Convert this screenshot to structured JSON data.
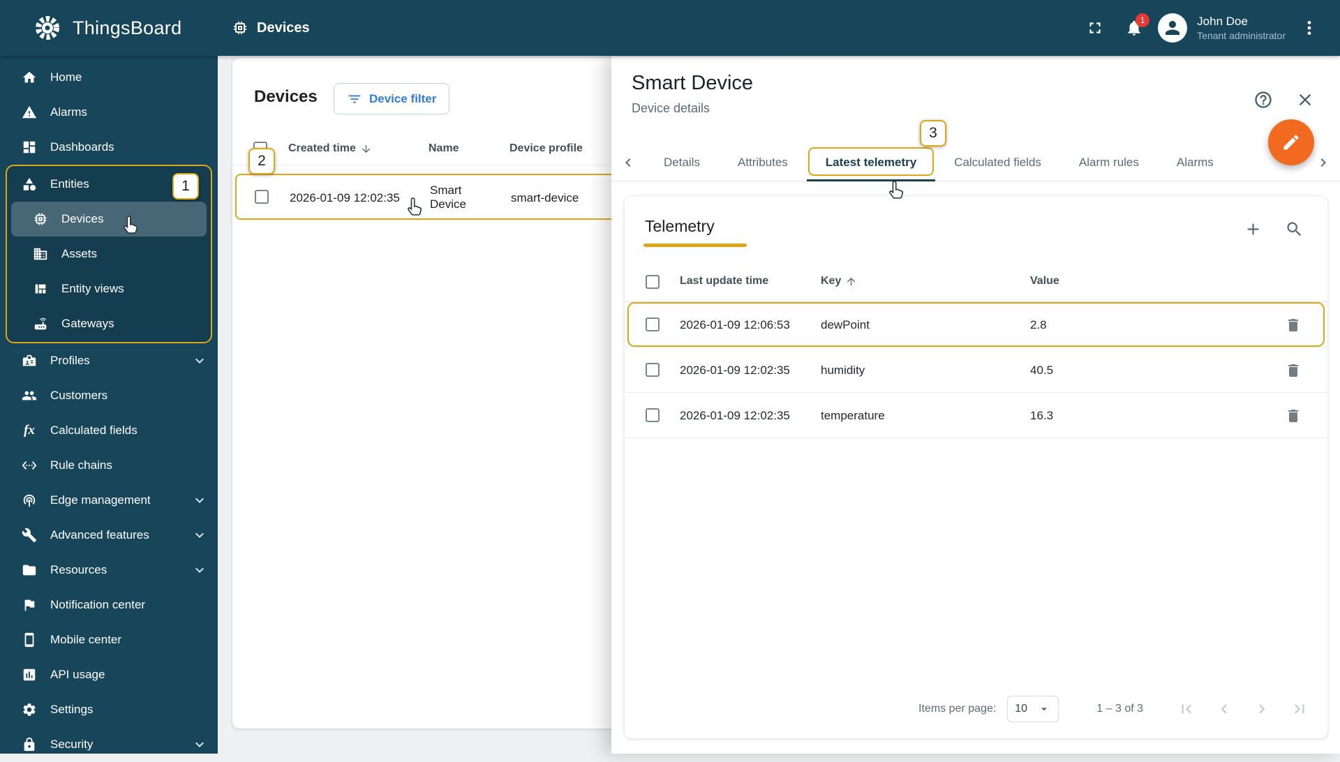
{
  "app": {
    "name": "ThingsBoard"
  },
  "header": {
    "breadcrumb": "Devices",
    "notification_count": "1",
    "user_name": "John Doe",
    "user_role": "Tenant administrator"
  },
  "sidebar": {
    "items": [
      "Home",
      "Alarms",
      "Dashboards",
      "Entities",
      "Devices",
      "Assets",
      "Entity views",
      "Gateways",
      "Profiles",
      "Customers",
      "Calculated fields",
      "Rule chains",
      "Edge management",
      "Advanced features",
      "Resources",
      "Notification center",
      "Mobile center",
      "API usage",
      "Settings",
      "Security"
    ],
    "fx_icon_text": "fx"
  },
  "annotations": {
    "step1": "1",
    "step2": "2",
    "step3": "3"
  },
  "devices_page": {
    "title": "Devices",
    "filter_button": "Device filter",
    "columns": {
      "created_time": "Created time",
      "name": "Name",
      "device_profile": "Device profile"
    },
    "row": {
      "created_time": "2026-01-09 12:02:35",
      "name": "Smart Device",
      "device_profile": "smart-device"
    }
  },
  "panel": {
    "title": "Smart Device",
    "subtitle": "Device details",
    "tabs": [
      "Details",
      "Attributes",
      "Latest telemetry",
      "Calculated fields",
      "Alarm rules",
      "Alarms"
    ],
    "selected_tab": "Latest telemetry",
    "telemetry": {
      "title": "Telemetry",
      "columns": {
        "last_update_time": "Last update time",
        "key": "Key",
        "value": "Value"
      },
      "rows": [
        {
          "time": "2026-01-09 12:06:53",
          "key": "dewPoint",
          "value": "2.8"
        },
        {
          "time": "2026-01-09 12:02:35",
          "key": "humidity",
          "value": "40.5"
        },
        {
          "time": "2026-01-09 12:02:35",
          "key": "temperature",
          "value": "16.3"
        }
      ],
      "footer": {
        "items_per_page_label": "Items per page:",
        "items_per_page": "10",
        "range": "1 – 3 of 3"
      }
    }
  },
  "colors": {
    "annotation": "#dca718",
    "primary": "#2e7ce0",
    "fab": "#f26a1f",
    "chrome": "#17455a"
  }
}
